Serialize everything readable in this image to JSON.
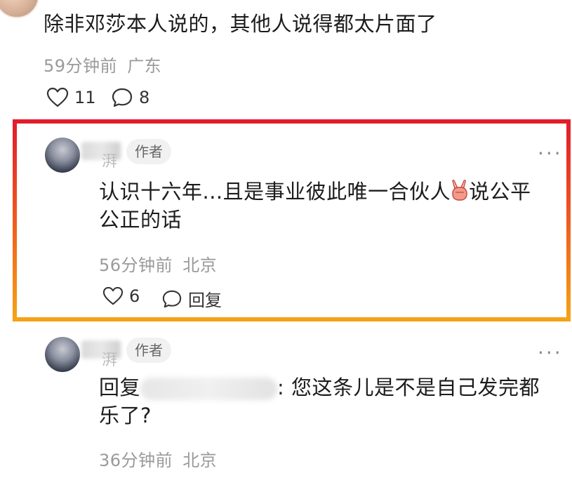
{
  "comments": [
    {
      "text": "除非邓莎本人说的，其他人说得都太片面了",
      "time": "59分钟前",
      "location": "广东",
      "likes": "11",
      "replies": "8"
    },
    {
      "badge": "作者",
      "name_visible": "湃",
      "text_line1": "认识十六年...且是事业彼此唯一合伙人",
      "text_tail": "说公平",
      "text_line2": "公正的话",
      "emoji": "victory-hand-emoji",
      "time": "56分钟前",
      "location": "北京",
      "likes": "6",
      "reply_label": "回复",
      "more": "···"
    },
    {
      "badge": "作者",
      "name_visible": "湃",
      "reply_prefix": "回复",
      "text_line1": ": 您这条儿是不是自己发完都",
      "text_line2": "乐了?",
      "time": "36分钟前",
      "location": "北京",
      "more": "···"
    }
  ],
  "colors": {
    "highlight_top": "#e11d2b",
    "highlight_bottom": "#f5a214",
    "meta_text": "#9a9a9a",
    "badge_bg": "#f1f1f1"
  }
}
